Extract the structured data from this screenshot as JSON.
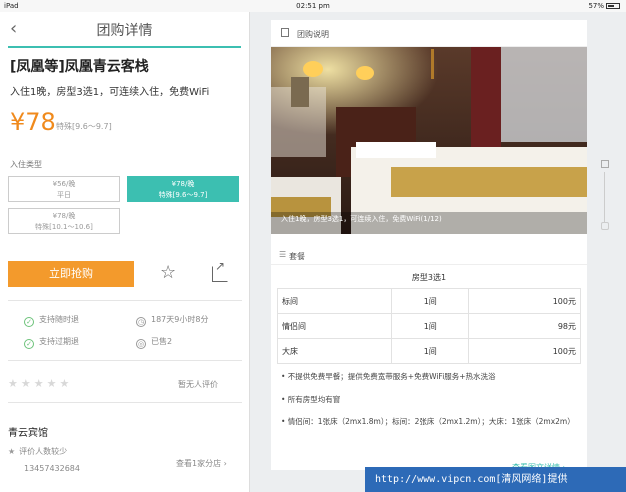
{
  "status_bar": {
    "carrier": "iPad",
    "time": "02:51 pm",
    "battery": "57%"
  },
  "left": {
    "nav_title": "团购详情",
    "back_icon": "‹",
    "hotel_name": "[凤凰等]凤凰青云客栈",
    "hotel_desc": "入住1晚，房型3选1，可连续入住，免费WiFi",
    "price": "¥78",
    "price_note": "特殊[9.6～9.7]",
    "room_type_label": "入住类型",
    "options": [
      {
        "line1": "¥56/晚",
        "line2": "平日"
      },
      {
        "line1": "¥78/晚",
        "line2": "特殊[9.6～9.7]"
      },
      {
        "line1": "¥78/晚",
        "line2": "特殊[10.1～10.6]"
      }
    ],
    "buy_button": "立即抢购",
    "features": [
      {
        "text": "支持随时退"
      },
      {
        "text": "187天9小时8分"
      },
      {
        "text": "支持过期退"
      },
      {
        "text": "已售2"
      }
    ],
    "rating_stars": "★★★★★",
    "no_review": "暂无人评价",
    "shop_name": "青云宾馆",
    "shop_reviews": "评价人数较少",
    "branches": "查看1家分店 ›",
    "phone": "13457432684"
  },
  "right": {
    "header_title": "团购说明",
    "photo_caption": "入住1晚，房型3选1，可连续入住，免费WiFi(1/12)",
    "package_title": "套餐",
    "table_title": "房型3选1",
    "table_rows": [
      [
        "标间",
        "1间",
        "100元"
      ],
      [
        "情侣间",
        "1间",
        "98元"
      ],
      [
        "大床",
        "1间",
        "100元"
      ]
    ],
    "notes": [
      "• 不提供免费早餐；提供免费宽带服务+免费WiFi服务+热水洗浴",
      "• 所有房型均有窗",
      "• 情侣间：1张床（2mx1.8m）；标间：2张床（2mx1.2m）；大床：1张床（2mx2m）"
    ],
    "more_link": "查看图文详情 ›"
  },
  "watermark": "http://www.vipcn.com[清风网络]提供",
  "colors": {
    "accent": "#3cbfb1",
    "price": "#f08a1c",
    "buy_button": "#f39a2c"
  }
}
